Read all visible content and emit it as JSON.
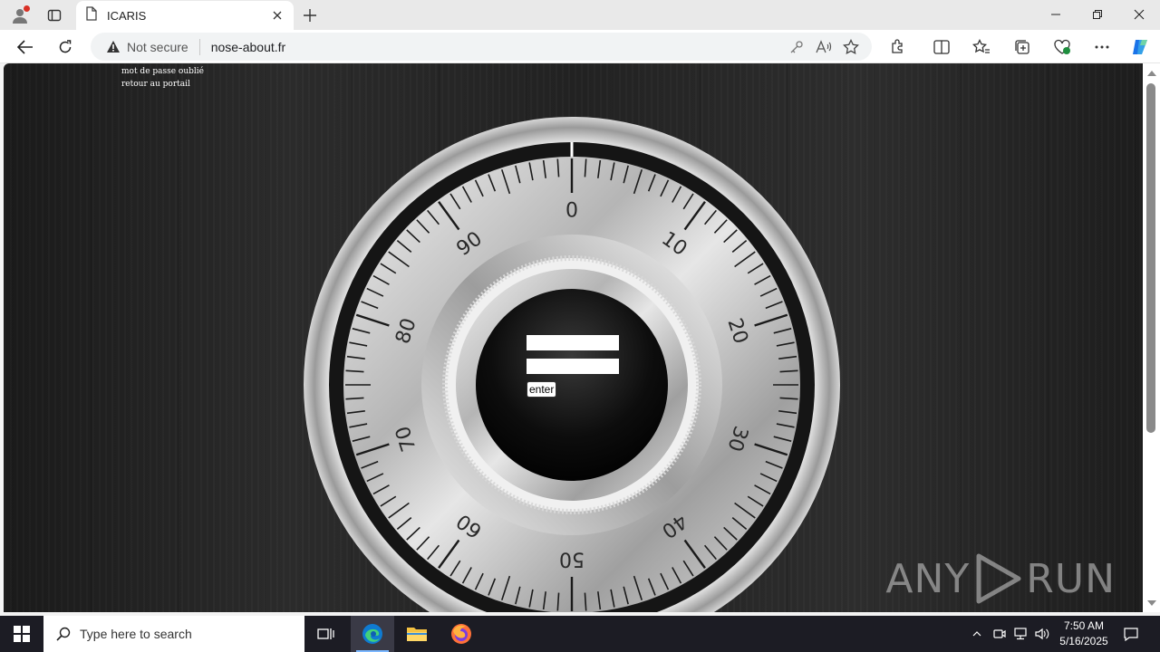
{
  "browser": {
    "tab": {
      "title": "ICARIS"
    },
    "address_bar": {
      "security_label": "Not secure",
      "url": "nose-about.fr"
    },
    "icons": [
      "profile-icon",
      "tab-actions-icon",
      "page-icon",
      "close-icon",
      "plus-icon",
      "minimize-icon",
      "restore-icon",
      "back-icon",
      "refresh-icon",
      "warning-icon",
      "key-icon",
      "read-aloud-icon",
      "star-icon",
      "extensions-icon",
      "split-screen-icon",
      "favorites-icon",
      "collections-icon",
      "performance-icon",
      "more-icon",
      "copilot-icon"
    ]
  },
  "page": {
    "links": [
      "mot de passe oublié",
      "retour au portail"
    ],
    "dial_numbers": [
      "0",
      "10",
      "20",
      "30",
      "40",
      "50",
      "60",
      "70",
      "80",
      "90"
    ],
    "login": {
      "username_value": "",
      "password_value": "",
      "submit_label": "enter"
    },
    "watermark": {
      "left": "ANY",
      "right": "RUN"
    }
  },
  "taskbar": {
    "search_placeholder": "Type here to search",
    "time": "7:50 AM",
    "date": "5/16/2025",
    "apps": [
      "task-view-icon",
      "edge-icon",
      "file-explorer-icon",
      "firefox-icon"
    ]
  },
  "colors": {
    "accent": "#1a73e8",
    "page_bg": "#222222",
    "taskbar_bg": "#1c1c24"
  }
}
